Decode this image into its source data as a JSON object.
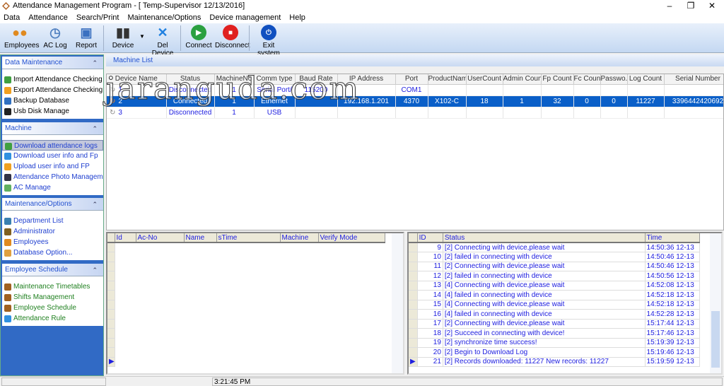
{
  "window": {
    "title": "Attendance Management Program - [ Temp-Supervisor 12/13/2016]"
  },
  "menu": [
    "Data",
    "Attendance",
    "Search/Print",
    "Maintenance/Options",
    "Device management",
    "Help"
  ],
  "toolbar": [
    {
      "label": "Employees",
      "icon": "employees-icon",
      "color": "#e08a20"
    },
    {
      "label": "AC Log",
      "icon": "clock-log-icon",
      "color": "#5080c0"
    },
    {
      "label": "Report",
      "icon": "folder-report-icon",
      "color": "#3a70c0"
    },
    {
      "label": "Device",
      "icon": "device-icon",
      "color": "#333"
    },
    {
      "label": "Del Device",
      "icon": "x-icon",
      "color": "#2080e0"
    },
    {
      "label": "Connect",
      "icon": "play-icon",
      "color": "#2aa040"
    },
    {
      "label": "Disconnect",
      "icon": "stop-icon",
      "color": "#e02020"
    },
    {
      "label": "Exit system",
      "icon": "power-icon",
      "color": "#1050c0"
    }
  ],
  "sidebar": [
    {
      "title": "Data Maintenance",
      "color": "#000",
      "items": [
        {
          "label": "Import Attendance Checking Data",
          "icon": "import-arrow-icon",
          "c": "#40a040"
        },
        {
          "label": "Export Attendance Checking Data",
          "icon": "export-arrow-icon",
          "c": "#f0a020"
        },
        {
          "label": "Backup Database",
          "icon": "backup-icon",
          "c": "#3070c0"
        },
        {
          "label": "Usb Disk Manage",
          "icon": "usb-icon",
          "c": "#222"
        }
      ]
    },
    {
      "title": "Machine",
      "color": "#2040d0",
      "items": [
        {
          "label": "Download attendance logs",
          "icon": "download-icon",
          "c": "#40a040"
        },
        {
          "label": "Download user info and Fp",
          "icon": "download-circle-icon",
          "c": "#3090e0"
        },
        {
          "label": "Upload user info and FP",
          "icon": "upload-icon",
          "c": "#f0a020"
        },
        {
          "label": "Attendance Photo Management",
          "icon": "photo-icon",
          "c": "#334"
        },
        {
          "label": "AC Manage",
          "icon": "ac-manage-icon",
          "c": "#60b060"
        }
      ]
    },
    {
      "title": "Maintenance/Options",
      "color": "#2040d0",
      "items": [
        {
          "label": "Department List",
          "icon": "department-icon",
          "c": "#3a80b0"
        },
        {
          "label": "Administrator",
          "icon": "administrator-icon",
          "c": "#806020"
        },
        {
          "label": "Employees",
          "icon": "employees-icon",
          "c": "#e08a20"
        },
        {
          "label": "Database Option...",
          "icon": "lock-icon",
          "c": "#e0a040"
        }
      ]
    },
    {
      "title": "Employee Schedule",
      "color": "#208020",
      "items": [
        {
          "label": "Maintenance Timetables",
          "icon": "timetable-icon",
          "c": "#a06020"
        },
        {
          "label": "Shifts Management",
          "icon": "shift-icon",
          "c": "#a06020"
        },
        {
          "label": "Employee Schedule",
          "icon": "schedule-icon",
          "c": "#a06020"
        },
        {
          "label": "Attendance Rule",
          "icon": "rule-dot-icon",
          "c": "#3090e0"
        }
      ]
    }
  ],
  "machine_list": {
    "title": "Machine List",
    "columns": [
      "Device Name",
      "Status",
      "MachineNo",
      "Comm type",
      "Baud Rate",
      "IP Address",
      "Port",
      "ProductName",
      "UserCount",
      "Admin Count",
      "Fp Count",
      "Fc Count",
      "Passwo...",
      "Log Count",
      "Serial Number"
    ],
    "rows": [
      [
        "1",
        "Disconnected",
        "1",
        "Serial Port/",
        "115200",
        "",
        "COM1",
        "",
        "",
        "",
        "",
        "",
        "",
        "",
        ""
      ],
      [
        "2",
        "Connected",
        "1",
        "Ethernet",
        "",
        "192.168.1.201",
        "4370",
        "X102-C",
        "18",
        "1",
        "32",
        "0",
        "0",
        "11227",
        "3396442420692"
      ],
      [
        "3",
        "Disconnected",
        "1",
        "USB",
        "",
        "",
        "",
        "",
        "",
        "",
        "",
        "",
        "",
        "",
        ""
      ]
    ],
    "selected": 1
  },
  "logs_grid": {
    "columns": [
      "Id",
      "Ac-No",
      "Name",
      "sTime",
      "Machine",
      "Verify Mode"
    ]
  },
  "status_grid": {
    "columns": [
      "ID",
      "Status",
      "Time"
    ],
    "rows": [
      [
        "9",
        "[2] Connecting with device,please wait",
        "14:50:36 12-13"
      ],
      [
        "10",
        "[2] failed in connecting with device",
        "14:50:46 12-13"
      ],
      [
        "11",
        "[2] Connecting with device,please wait",
        "14:50:46 12-13"
      ],
      [
        "12",
        "[2] failed in connecting with device",
        "14:50:56 12-13"
      ],
      [
        "13",
        "[4] Connecting with device,please wait",
        "14:52:08 12-13"
      ],
      [
        "14",
        "[4] failed in connecting with device",
        "14:52:18 12-13"
      ],
      [
        "15",
        "[4] Connecting with device,please wait",
        "14:52:18 12-13"
      ],
      [
        "16",
        "[4] failed in connecting with device",
        "14:52:28 12-13"
      ],
      [
        "17",
        "[2] Connecting with device,please wait",
        "15:17:44 12-13"
      ],
      [
        "18",
        "[2] Succeed in connecting with device!",
        "15:17:46 12-13"
      ],
      [
        "19",
        "[2] synchronize time success!",
        "15:19:39 12-13"
      ],
      [
        "20",
        "[2] Begin to Download Log",
        "15:19:46 12-13"
      ],
      [
        "21",
        "[2]  Records downloaded: 11227 New records: 11227",
        "15:19:59 12-13"
      ]
    ]
  },
  "statusbar": {
    "time": "3:21:45 PM"
  },
  "watermark": "jaranguda.com"
}
